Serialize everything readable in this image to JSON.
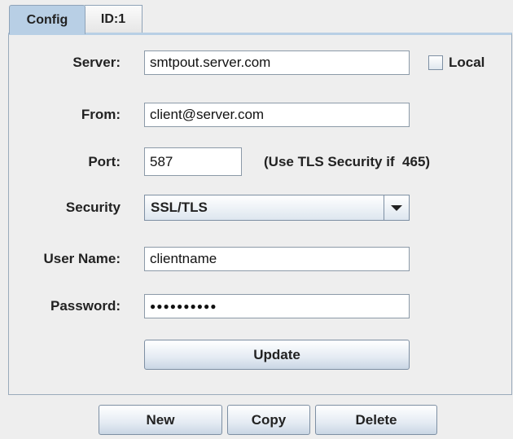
{
  "tabs": [
    {
      "label": "Config",
      "active": true
    },
    {
      "label": "ID:1",
      "active": false
    }
  ],
  "form": {
    "server_label": "Server:",
    "server_value": "smtpout.server.com",
    "local_label": "Local",
    "local_checked": false,
    "from_label": "From:",
    "from_value": "client@server.com",
    "port_label": "Port:",
    "port_value": "587",
    "port_hint": "(Use TLS Security if  465)",
    "security_label": "Security",
    "security_value": "SSL/TLS",
    "username_label": "User Name:",
    "username_value": "clientname",
    "password_label": "Password:",
    "password_masked": "●●●●●●●●●●",
    "update_label": "Update"
  },
  "footer": {
    "new_label": "New",
    "copy_label": "Copy",
    "delete_label": "Delete"
  },
  "icons": {
    "combo_arrow": "chevron-down-icon",
    "local_checkbox": "checkbox-unchecked"
  }
}
